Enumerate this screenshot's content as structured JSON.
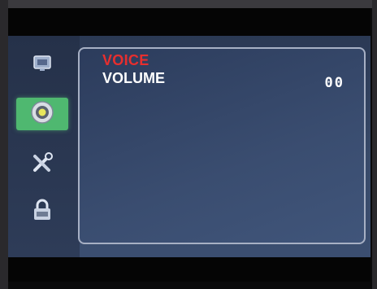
{
  "sidebar": {
    "items": [
      {
        "icon": "picture-icon",
        "active": false
      },
      {
        "icon": "audio-disc-icon",
        "active": true
      },
      {
        "icon": "tools-icon",
        "active": false
      },
      {
        "icon": "lock-icon",
        "active": false
      }
    ]
  },
  "menu": {
    "category_label": "VOICE",
    "items": [
      {
        "label": "VOLUME",
        "value": "00"
      }
    ]
  },
  "colors": {
    "category": "#e82e2e",
    "active_highlight": "#4fb870",
    "panel_border": "#a7b0c4"
  }
}
